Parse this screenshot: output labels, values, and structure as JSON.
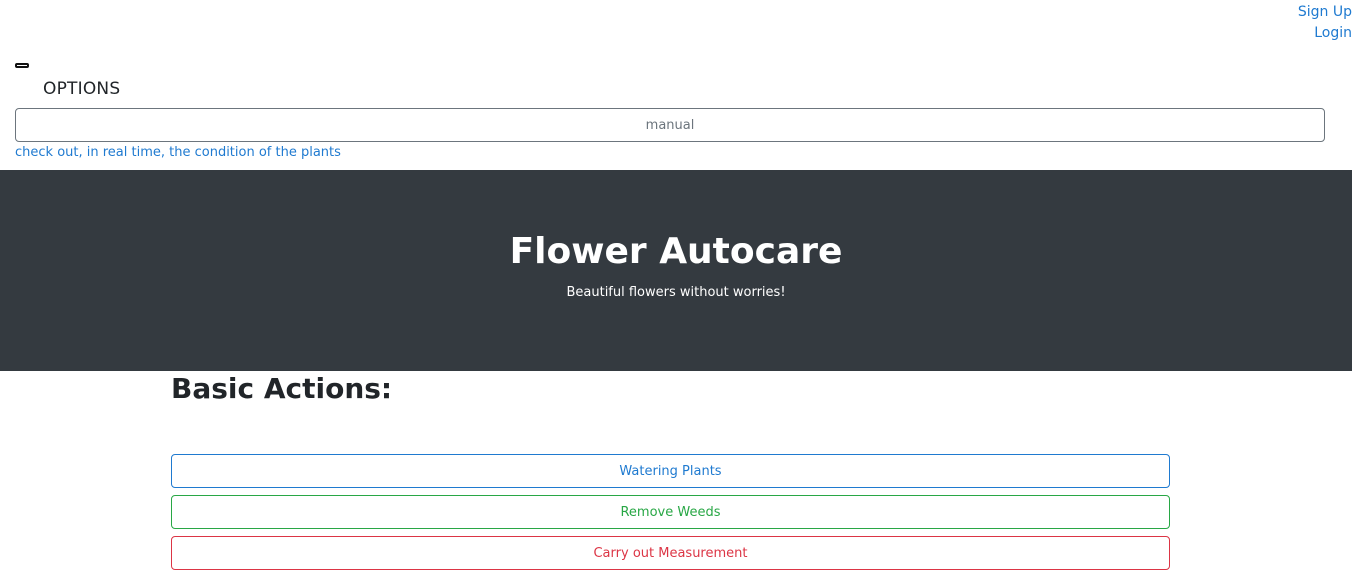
{
  "auth": {
    "signup_label": "Sign Up",
    "login_label": "Login"
  },
  "options": {
    "label": "OPTIONS",
    "mode_value": "manual",
    "status_link": "check out, in real time, the condition of the plants"
  },
  "hero": {
    "title": "Flower Autocare",
    "subtitle": "Beautiful flowers without worries!"
  },
  "actions": {
    "heading": "Basic Actions:",
    "buttons": [
      {
        "label": "Watering Plants",
        "color": "#1f7ad0"
      },
      {
        "label": "Remove Weeds",
        "color": "#28a745"
      },
      {
        "label": "Carry out Measurement",
        "color": "#dc3545"
      }
    ]
  },
  "colors": {
    "link": "#1f7ad0",
    "hero_bg": "#343a40"
  }
}
